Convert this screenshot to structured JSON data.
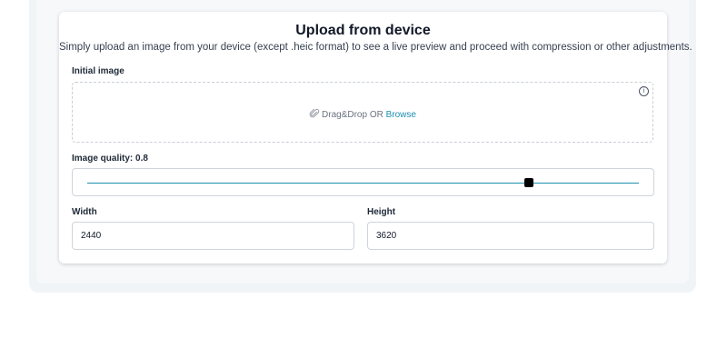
{
  "card": {
    "title": "Upload from device",
    "subtitle": "Simply upload an image from your device (except .heic format) to see a live preview and proceed with compression or other adjustments."
  },
  "initial_image": {
    "label": "Initial image",
    "info_icon": "info-icon",
    "drop_icon": "paperclip-icon",
    "drop_text": "Drag&Drop OR ",
    "browse_label": "Browse"
  },
  "quality": {
    "label": "Image quality: 0.8",
    "value": 0.8
  },
  "dimensions": {
    "width_label": "Width",
    "width_value": "2440",
    "height_label": "Height",
    "height_value": "3620"
  },
  "colors": {
    "accent": "#1b8fb0",
    "background": "#f1f4f7"
  }
}
